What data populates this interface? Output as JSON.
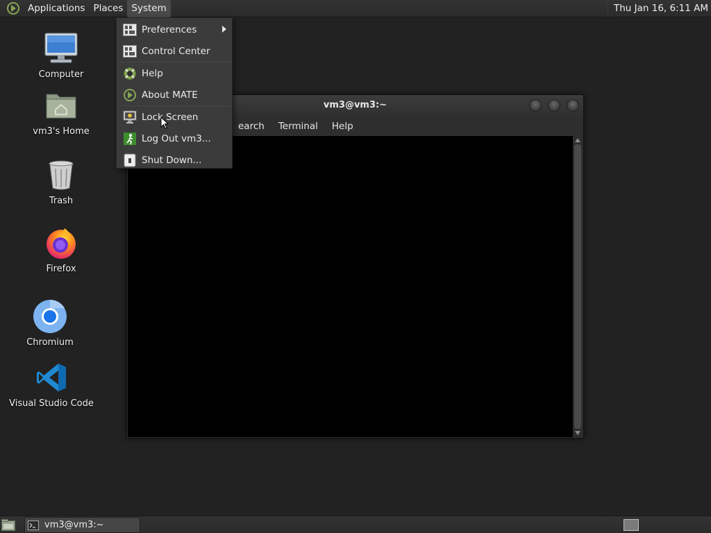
{
  "top_panel": {
    "menus": [
      "Applications",
      "Places",
      "System"
    ],
    "active_menu": "System",
    "clock": "Thu Jan 16,  6:11 AM",
    "logo_icon": "mate-logo-icon"
  },
  "desktop": {
    "icons": [
      {
        "label": "Computer",
        "icon": "computer-icon"
      },
      {
        "label": "vm3's Home",
        "icon": "home-folder-icon"
      },
      {
        "label": "Trash",
        "icon": "trash-icon"
      },
      {
        "label": "Firefox",
        "icon": "firefox-icon"
      },
      {
        "label": "Chromium",
        "icon": "chromium-icon"
      },
      {
        "label": "Visual Studio Code",
        "icon": "vscode-icon"
      }
    ]
  },
  "system_menu": {
    "items": [
      {
        "label": "Preferences",
        "icon": "preferences-icon",
        "submenu": true
      },
      {
        "label": "Control Center",
        "icon": "control-center-icon"
      },
      {
        "label": "Help",
        "icon": "help-icon"
      },
      {
        "label": "About MATE",
        "icon": "about-mate-icon"
      },
      {
        "label": "Lock Screen",
        "icon": "lock-screen-icon"
      },
      {
        "label": "Log Out vm3...",
        "icon": "logout-icon"
      },
      {
        "label": "Shut Down...",
        "icon": "shutdown-icon"
      }
    ]
  },
  "terminal_window": {
    "title": "vm3@vm3:~",
    "menu_visible": [
      "earch",
      "Terminal",
      "Help"
    ]
  },
  "bottom_panel": {
    "task_label": "vm3@vm3:~"
  },
  "colors": {
    "desktop_bg": "#222222",
    "panel_bg": "#2e2e2e",
    "menu_bg": "#3b3b3b",
    "terminal_bg": "#000000",
    "mate_green": "#87a556"
  }
}
